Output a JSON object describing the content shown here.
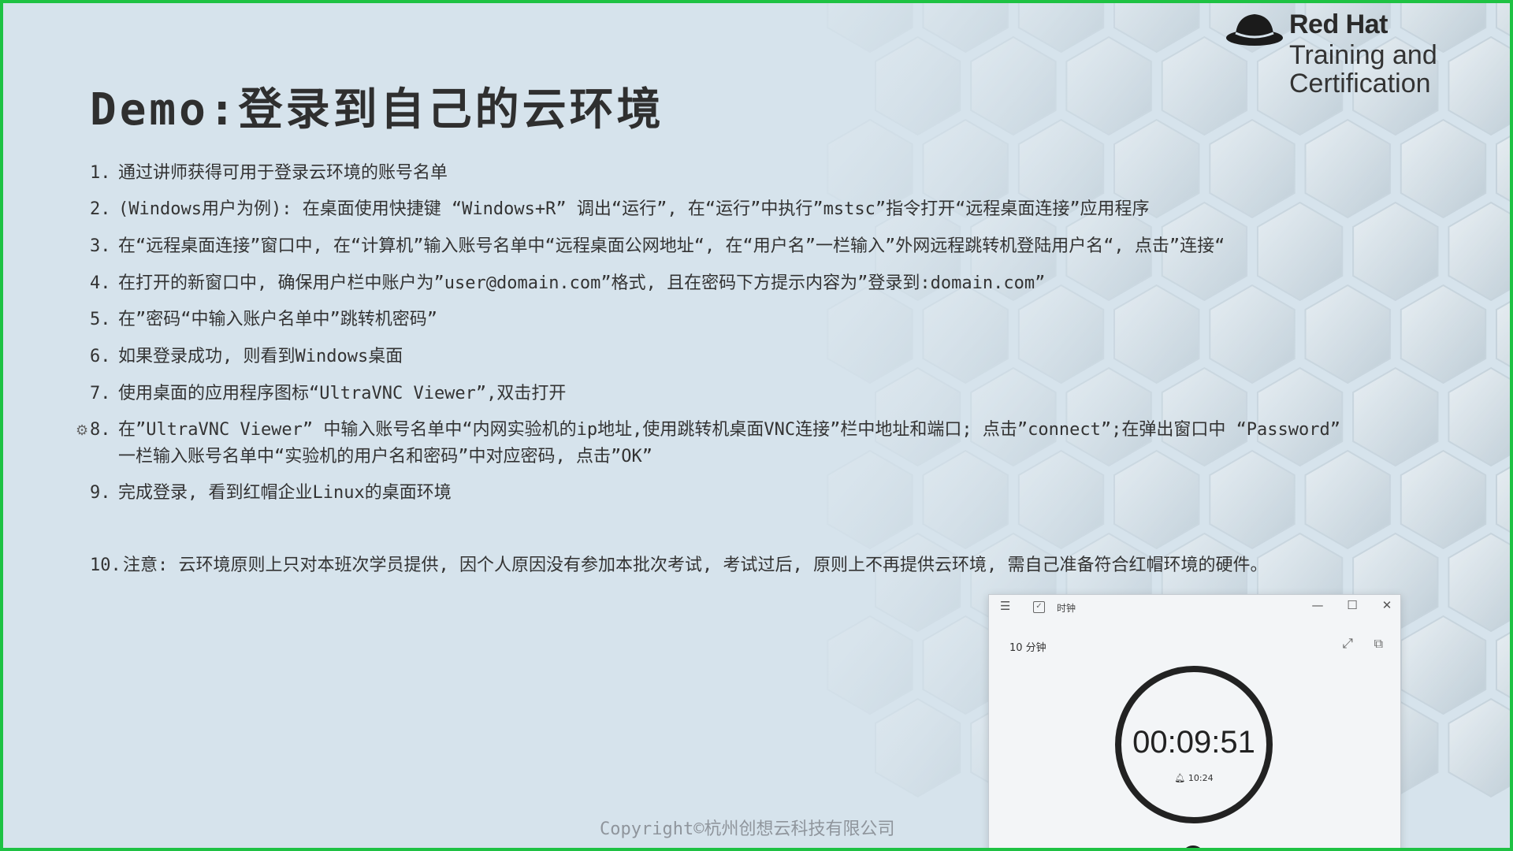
{
  "brand": {
    "name": "Red Hat",
    "line1": "Training and",
    "line2": "Certification"
  },
  "slide": {
    "title": "Demo:登录到自己的云环境",
    "steps": [
      {
        "num": "1.",
        "text": "通过讲师获得可用于登录云环境的账号名单"
      },
      {
        "num": "2.",
        "text": "(Windows用户为例): 在桌面使用快捷键 “Windows+R” 调出“运行”, 在“运行”中执行”mstsc”指令打开“远程桌面连接”应用程序"
      },
      {
        "num": "3.",
        "text": "在“远程桌面连接”窗口中, 在“计算机”输入账号名单中“远程桌面公网地址“, 在“用户名”一栏输入”外网远程跳转机登陆用户名“, 点击”连接“"
      },
      {
        "num": "4.",
        "text": "在打开的新窗口中, 确保用户栏中账户为”user@domain.com”格式, 且在密码下方提示内容为”登录到:domain.com”"
      },
      {
        "num": "5.",
        "text": "在”密码“中输入账户名单中”跳转机密码”"
      },
      {
        "num": "6.",
        "text": "如果登录成功, 则看到Windows桌面"
      },
      {
        "num": "7.",
        "text": "使用桌面的应用程序图标“UltraVNC Viewer”,双击打开"
      },
      {
        "num": "8.",
        "text": "在”UltraVNC Viewer” 中输入账号名单中“内网实验机的ip地址,使用跳转机桌面VNC连接”栏中地址和端口; 点击”connect”;在弹出窗口中 “Password”",
        "cont": "一栏输入账号名单中“实验机的用户名和密码”中对应密码, 点击”OK”"
      },
      {
        "num": "9.",
        "text": "完成登录, 看到红帽企业Linux的桌面环境"
      },
      {
        "num": "10.",
        "text": "注意: 云环境原则上只对本班次学员提供, 因个人原因没有参加本批次考试, 考试过后, 原则上不再提供云环境, 需自己准备符合红帽环境的硬件。"
      }
    ],
    "copyright": "Copyright©杭州创想云科技有限公司"
  },
  "clock_window": {
    "menu_icon": "hamburger-icon",
    "app_title": "时钟",
    "minimize": "—",
    "maximize": "☐",
    "close": "✕",
    "timer_label": "10 分钟",
    "remaining": "00:09:51",
    "alarm_time": "10:24"
  },
  "colors": {
    "frame": "#1ec243",
    "background": "#d6e3ec",
    "text": "#333333"
  }
}
